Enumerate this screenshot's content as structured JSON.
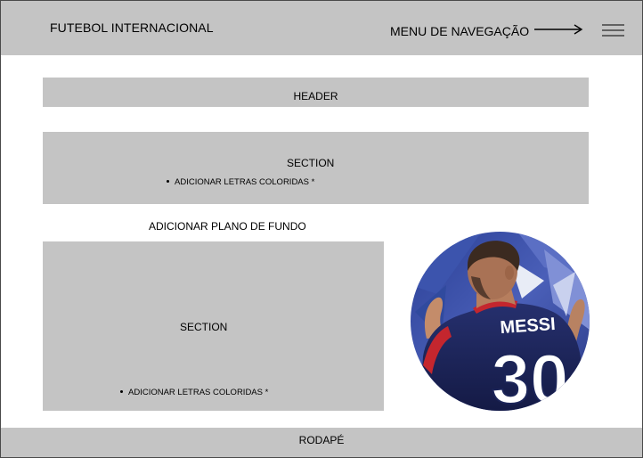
{
  "topbar": {
    "brand": "FUTEBOL INTERNACIONAL",
    "nav_label": "MENU DE NAVEGAÇÃO",
    "arrow_icon": "arrow-right-icon",
    "menu_icon": "hamburger-menu-icon"
  },
  "header": {
    "label": "HEADER"
  },
  "section_top": {
    "label": "SECTION",
    "note": "ADICIONAR LETRAS COLORIDAS *"
  },
  "background_note": "ADICIONAR PLANO DE FUNDO",
  "section_bottom": {
    "label": "SECTION",
    "note": "ADICIONAR LETRAS COLORIDAS *"
  },
  "photo": {
    "jersey_name": "MESSI",
    "jersey_number": "30"
  },
  "footer": {
    "label": "RODAPÉ"
  },
  "colors": {
    "placeholder_gray": "#c4c4c4",
    "jersey_navy": "#1f2a68",
    "background_blue": "#3a4fa5"
  }
}
